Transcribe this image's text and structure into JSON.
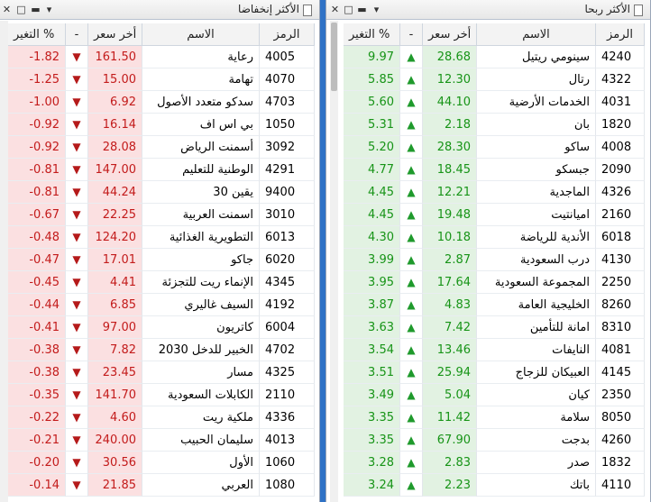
{
  "losers": {
    "title": "الأكثر إنخفاضا",
    "headers": {
      "code": "الرمز",
      "name": "الاسم",
      "price": "أخر سعر",
      "arrow": "-",
      "change": "التغير %"
    },
    "rows": [
      {
        "code": "4005",
        "name": "رعاية",
        "price": "161.50",
        "change": "-1.82"
      },
      {
        "code": "4070",
        "name": "تهامة",
        "price": "15.00",
        "change": "-1.25"
      },
      {
        "code": "4703",
        "name": "سدكو متعدد الأصول",
        "price": "6.92",
        "change": "-1.00"
      },
      {
        "code": "1050",
        "name": "بي اس اف",
        "price": "16.14",
        "change": "-0.92"
      },
      {
        "code": "3092",
        "name": "أسمنت الرياض",
        "price": "28.08",
        "change": "-0.92"
      },
      {
        "code": "4291",
        "name": "الوطنية للتعليم",
        "price": "147.00",
        "change": "-0.81"
      },
      {
        "code": "9400",
        "name": "يقين 30",
        "price": "44.24",
        "change": "-0.81"
      },
      {
        "code": "3010",
        "name": "اسمنت العربية",
        "price": "22.25",
        "change": "-0.67"
      },
      {
        "code": "6013",
        "name": "التطويرية الغذائية",
        "price": "124.20",
        "change": "-0.48"
      },
      {
        "code": "6020",
        "name": "جاكو",
        "price": "17.01",
        "change": "-0.47"
      },
      {
        "code": "4345",
        "name": "الإنماء ريت للتجزئة",
        "price": "4.41",
        "change": "-0.45"
      },
      {
        "code": "4192",
        "name": "السيف غاليري",
        "price": "6.85",
        "change": "-0.44"
      },
      {
        "code": "6004",
        "name": "كاتريون",
        "price": "97.00",
        "change": "-0.41"
      },
      {
        "code": "4702",
        "name": "الخبير للدخل 2030",
        "price": "7.82",
        "change": "-0.38"
      },
      {
        "code": "4325",
        "name": "مسار",
        "price": "23.45",
        "change": "-0.38"
      },
      {
        "code": "2110",
        "name": "الكابلات السعودية",
        "price": "141.70",
        "change": "-0.35"
      },
      {
        "code": "4336",
        "name": "ملكية ريت",
        "price": "4.60",
        "change": "-0.22"
      },
      {
        "code": "4013",
        "name": "سليمان الحبيب",
        "price": "240.00",
        "change": "-0.21"
      },
      {
        "code": "1060",
        "name": "الأول",
        "price": "30.56",
        "change": "-0.20"
      },
      {
        "code": "1080",
        "name": "العربي",
        "price": "21.85",
        "change": "-0.14"
      }
    ]
  },
  "gainers": {
    "title": "الأكثر ربحا",
    "headers": {
      "code": "الرمز",
      "name": "الاسم",
      "price": "أخر سعر",
      "arrow": "-",
      "change": "التغير %"
    },
    "rows": [
      {
        "code": "4240",
        "name": "سينومي ريتيل",
        "price": "28.68",
        "change": "9.97"
      },
      {
        "code": "4322",
        "name": "رتال",
        "price": "12.30",
        "change": "5.85"
      },
      {
        "code": "4031",
        "name": "الخدمات الأرضية",
        "price": "44.10",
        "change": "5.60"
      },
      {
        "code": "1820",
        "name": "بان",
        "price": "2.18",
        "change": "5.31"
      },
      {
        "code": "4008",
        "name": "ساكو",
        "price": "28.30",
        "change": "5.20"
      },
      {
        "code": "2090",
        "name": "جبسكو",
        "price": "18.45",
        "change": "4.77"
      },
      {
        "code": "4326",
        "name": "الماجدية",
        "price": "12.21",
        "change": "4.45"
      },
      {
        "code": "2160",
        "name": "اميانتيت",
        "price": "19.48",
        "change": "4.45"
      },
      {
        "code": "6018",
        "name": "الأندية للرياضة",
        "price": "10.18",
        "change": "4.30"
      },
      {
        "code": "4130",
        "name": "درب السعودية",
        "price": "2.87",
        "change": "3.99"
      },
      {
        "code": "2250",
        "name": "المجموعة السعودية",
        "price": "17.64",
        "change": "3.95"
      },
      {
        "code": "8260",
        "name": "الخليجية العامة",
        "price": "4.83",
        "change": "3.87"
      },
      {
        "code": "8310",
        "name": "امانة للتأمين",
        "price": "7.42",
        "change": "3.63"
      },
      {
        "code": "4081",
        "name": "النايفات",
        "price": "13.46",
        "change": "3.54"
      },
      {
        "code": "4145",
        "name": "العبيكان للزجاج",
        "price": "25.94",
        "change": "3.51"
      },
      {
        "code": "2350",
        "name": "كيان",
        "price": "5.04",
        "change": "3.49"
      },
      {
        "code": "8050",
        "name": "سلامة",
        "price": "11.42",
        "change": "3.35"
      },
      {
        "code": "4260",
        "name": "بدجت",
        "price": "67.90",
        "change": "3.35"
      },
      {
        "code": "1832",
        "name": "صدر",
        "price": "2.83",
        "change": "3.28"
      },
      {
        "code": "4110",
        "name": "باتك",
        "price": "2.23",
        "change": "3.24"
      }
    ]
  },
  "colors": {
    "loss": "#c31b1b",
    "gain": "#179417",
    "loss_bg": "#fbe0e1",
    "gain_bg": "#e2f2e2"
  },
  "icons": {
    "down": "down-arrow-icon",
    "up": "up-arrow-icon"
  }
}
